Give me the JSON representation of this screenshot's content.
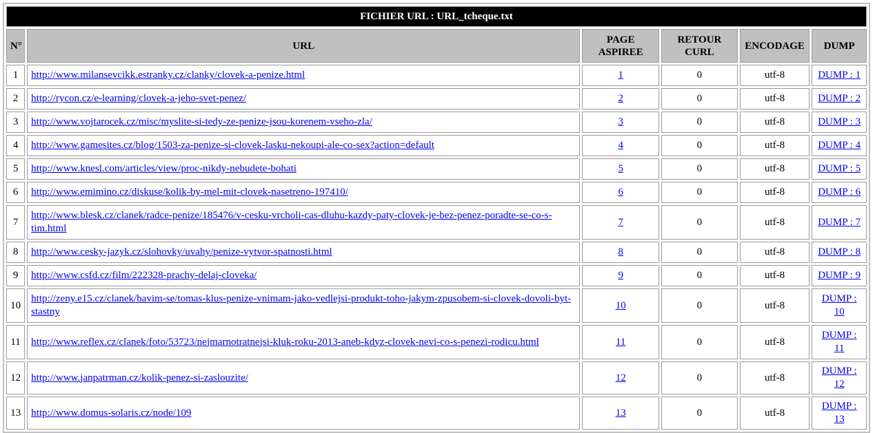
{
  "table": {
    "title": "FICHIER URL : URL_tcheque.txt",
    "headers": {
      "num": "N°",
      "url": "URL",
      "page": "PAGE ASPIREE",
      "retour": "RETOUR CURL",
      "encodage": "ENCODAGE",
      "dump": "DUMP"
    },
    "rows": [
      {
        "n": "1",
        "url": "http://www.milansevcikk.estranky.cz/clanky/clovek-a-penize.html",
        "page": "1",
        "retour": "0",
        "enc": "utf-8",
        "dump": "DUMP : 1"
      },
      {
        "n": "2",
        "url": "http://rycon.cz/e-learning/clovek-a-jeho-svet-penez/",
        "page": "2",
        "retour": "0",
        "enc": "utf-8",
        "dump": "DUMP : 2"
      },
      {
        "n": "3",
        "url": "http://www.vojtarocek.cz/misc/myslite-si-tedy-ze-penize-jsou-korenem-vseho-zla/",
        "page": "3",
        "retour": "0",
        "enc": "utf-8",
        "dump": "DUMP : 3"
      },
      {
        "n": "4",
        "url": "http://www.gamesites.cz/blog/1503-za-penize-si-clovek-lasku-nekoupi-ale-co-sex?action=default",
        "page": "4",
        "retour": "0",
        "enc": "utf-8",
        "dump": "DUMP : 4"
      },
      {
        "n": "5",
        "url": "http://www.knesl.com/articles/view/proc-nikdy-nebudete-bohati",
        "page": "5",
        "retour": "0",
        "enc": "utf-8",
        "dump": "DUMP : 5"
      },
      {
        "n": "6",
        "url": "http://www.emimino.cz/diskuse/kolik-by-mel-mit-clovek-nasetreno-197410/",
        "page": "6",
        "retour": "0",
        "enc": "utf-8",
        "dump": "DUMP : 6"
      },
      {
        "n": "7",
        "url": "http://www.blesk.cz/clanek/radce-penize/185476/v-cesku-vrcholi-cas-dluhu-kazdy-paty-clovek-je-bez-penez-poradte-se-co-s-tim.html",
        "page": "7",
        "retour": "0",
        "enc": "utf-8",
        "dump": "DUMP : 7"
      },
      {
        "n": "8",
        "url": "http://www.cesky-jazyk.cz/slohovky/uvahy/penize-vytvor-spatnosti.html",
        "page": "8",
        "retour": "0",
        "enc": "utf-8",
        "dump": "DUMP : 8"
      },
      {
        "n": "9",
        "url": "http://www.csfd.cz/film/222328-prachy-delaj-cloveka/",
        "page": "9",
        "retour": "0",
        "enc": "utf-8",
        "dump": "DUMP : 9"
      },
      {
        "n": "10",
        "url": "http://zeny.e15.cz/clanek/bavim-se/tomas-klus-penize-vnimam-jako-vedlejsi-produkt-toho-jakym-zpusobem-si-clovek-dovoli-byt-stastny",
        "page": "10",
        "retour": "0",
        "enc": "utf-8",
        "dump": "DUMP : 10"
      },
      {
        "n": "11",
        "url": "http://www.reflex.cz/clanek/foto/53723/nejmarnotratnejsi-kluk-roku-2013-aneb-kdyz-clovek-nevi-co-s-penezi-rodicu.html",
        "page": "11",
        "retour": "0",
        "enc": "utf-8",
        "dump": "DUMP : 11"
      },
      {
        "n": "12",
        "url": "http://www.janpatrman.cz/kolik-penez-si-zaslouzite/",
        "page": "12",
        "retour": "0",
        "enc": "utf-8",
        "dump": "DUMP : 12"
      },
      {
        "n": "13",
        "url": "http://www.domus-solaris.cz/node/109",
        "page": "13",
        "retour": "0",
        "enc": "utf-8",
        "dump": "DUMP : 13"
      }
    ]
  }
}
